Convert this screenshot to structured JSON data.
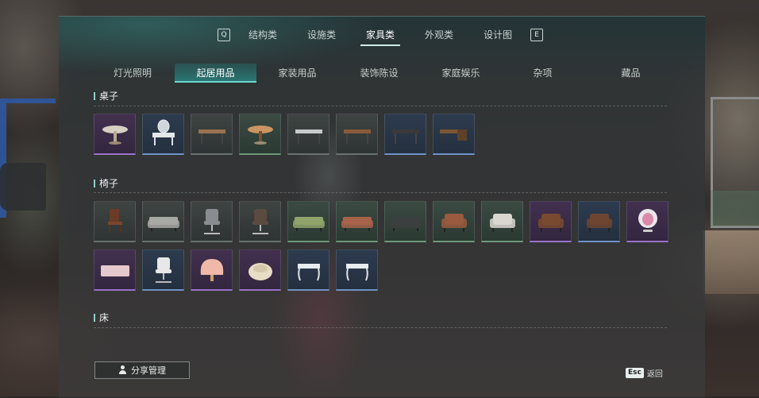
{
  "top_nav": {
    "prev_key": "Q",
    "next_key": "E",
    "tabs": [
      {
        "label": "结构类",
        "active": false
      },
      {
        "label": "设施类",
        "active": false
      },
      {
        "label": "家具类",
        "active": true
      },
      {
        "label": "外观类",
        "active": false
      },
      {
        "label": "设计图",
        "active": false
      }
    ]
  },
  "sub_nav": {
    "tabs": [
      {
        "label": "灯光照明",
        "active": false
      },
      {
        "label": "起居用品",
        "active": true
      },
      {
        "label": "家装用品",
        "active": false
      },
      {
        "label": "装饰陈设",
        "active": false
      },
      {
        "label": "家庭娱乐",
        "active": false
      },
      {
        "label": "杂项",
        "active": false
      },
      {
        "label": "藏品",
        "active": false
      }
    ]
  },
  "sections": [
    {
      "title": "桌子",
      "items": [
        {
          "icon": "round-table-icon",
          "rarity": "purple"
        },
        {
          "icon": "vanity-table-icon",
          "rarity": "blue"
        },
        {
          "icon": "wooden-table-icon",
          "rarity": "common"
        },
        {
          "icon": "round-wood-table-icon",
          "rarity": "green"
        },
        {
          "icon": "metal-table-icon",
          "rarity": "common"
        },
        {
          "icon": "side-table-icon",
          "rarity": "common"
        },
        {
          "icon": "long-dark-table-icon",
          "rarity": "blue"
        },
        {
          "icon": "corner-desk-icon",
          "rarity": "blue"
        }
      ]
    },
    {
      "title": "椅子",
      "items": [
        {
          "icon": "wooden-chair-icon",
          "rarity": "common"
        },
        {
          "icon": "grey-sofa-icon",
          "rarity": "common"
        },
        {
          "icon": "office-chair-icon",
          "rarity": "common"
        },
        {
          "icon": "leather-office-chair-icon",
          "rarity": "common"
        },
        {
          "icon": "green-sofa-icon",
          "rarity": "green"
        },
        {
          "icon": "brown-sofa-icon",
          "rarity": "green"
        },
        {
          "icon": "dark-sofa-icon",
          "rarity": "green"
        },
        {
          "icon": "brown-armchair-icon",
          "rarity": "green"
        },
        {
          "icon": "white-armchair-icon",
          "rarity": "green"
        },
        {
          "icon": "chesterfield-armchair-icon",
          "rarity": "purple"
        },
        {
          "icon": "leather-armchair-icon",
          "rarity": "blue"
        },
        {
          "icon": "egg-chair-icon",
          "rarity": "purple"
        },
        {
          "icon": "pink-bench-icon",
          "rarity": "purple"
        },
        {
          "icon": "white-swivel-chair-icon",
          "rarity": "blue"
        },
        {
          "icon": "shell-chair-icon",
          "rarity": "purple"
        },
        {
          "icon": "cream-pouf-icon",
          "rarity": "purple"
        },
        {
          "icon": "white-ornate-table-icon",
          "rarity": "blue"
        },
        {
          "icon": "white-ornate-stool-icon",
          "rarity": "blue"
        }
      ]
    },
    {
      "title": "床",
      "items": []
    }
  ],
  "footer": {
    "share_label": "分享管理",
    "back_key": "Esc",
    "back_label": "返回"
  }
}
